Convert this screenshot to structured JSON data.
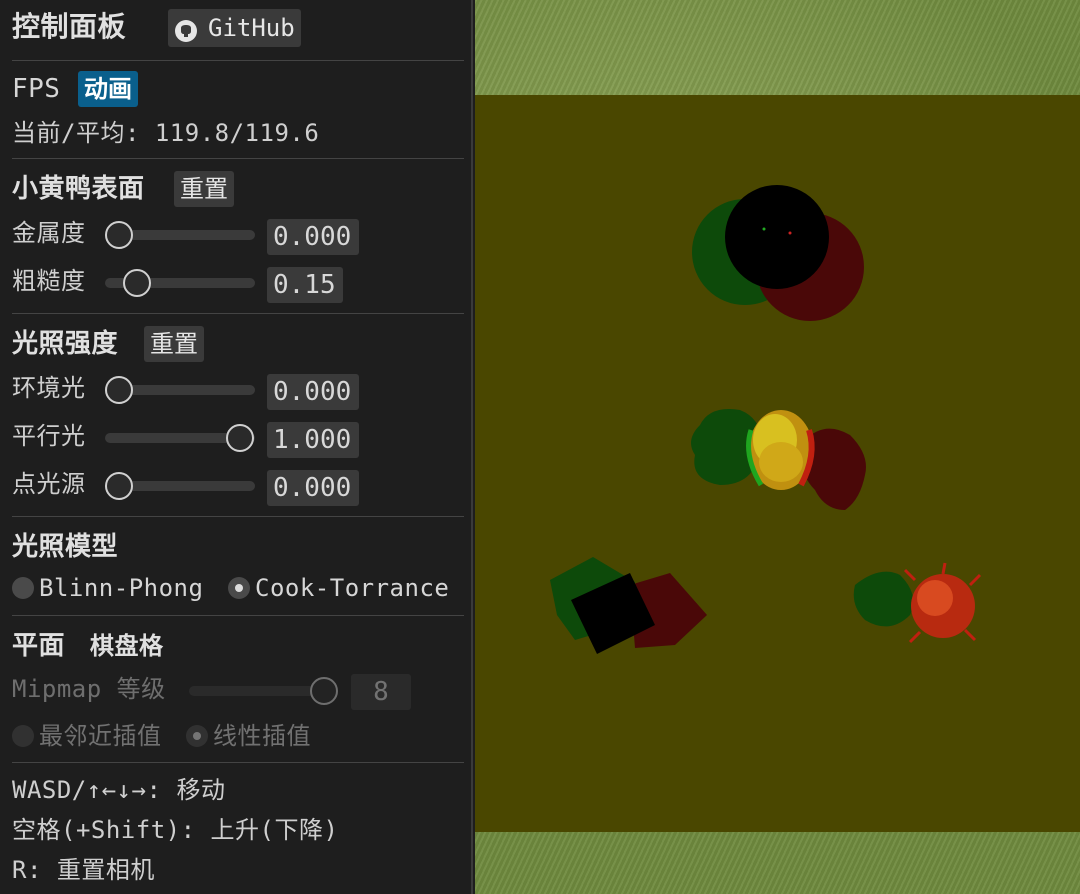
{
  "panel": {
    "title": "控制面板",
    "github_label": "GitHub",
    "fps": {
      "heading": "FPS",
      "animation_badge": "动画",
      "stats_label": "当前/平均:",
      "stats_value": "119.8/119.6"
    },
    "duck_surface": {
      "heading": "小黄鸭表面",
      "reset_label": "重置",
      "metallic": {
        "label": "金属度",
        "value": "0.000",
        "level": 0.0
      },
      "roughness": {
        "label": "粗糙度",
        "value": "0.15",
        "level": 0.15
      }
    },
    "light_intensity": {
      "heading": "光照强度",
      "reset_label": "重置",
      "ambient": {
        "label": "环境光",
        "value": "0.000",
        "level": 0.0
      },
      "directional": {
        "label": "平行光",
        "value": "1.000",
        "level": 1.0
      },
      "point": {
        "label": "点光源",
        "value": "0.000",
        "level": 0.0
      }
    },
    "lighting_model": {
      "heading": "光照模型",
      "options": [
        "Blinn-Phong",
        "Cook-Torrance"
      ],
      "selected": "Cook-Torrance"
    },
    "plane": {
      "heading": "平面",
      "sub_heading": "棋盘格",
      "mipmap_label": "Mipmap 等级",
      "mipmap_value": "8",
      "mipmap_level": 1.0,
      "filters": [
        "最邻近插值",
        "线性插值"
      ],
      "selected_filter": "线性插值"
    },
    "help": {
      "move": "WASD/↑←↓→: 移动",
      "updown": "空格(+Shift): 上升(下降)",
      "reset_camera": "R: 重置相机"
    }
  },
  "colors": {
    "panel_bg": "#1e1e1e",
    "accent": "#0a5f8c",
    "floor": "#4a4700",
    "grass": "#7c9548"
  }
}
